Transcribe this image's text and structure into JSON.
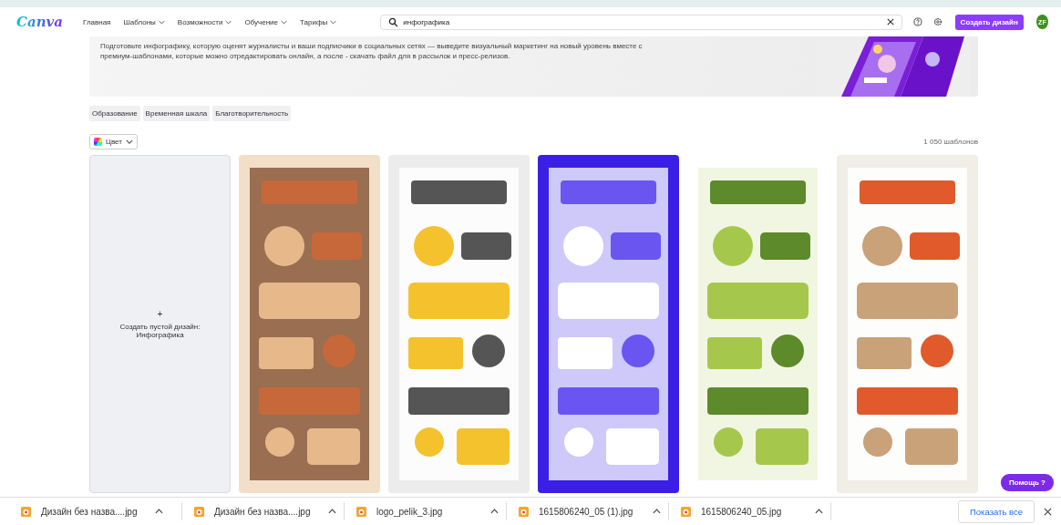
{
  "header": {
    "logo": "Canva",
    "nav": [
      {
        "label": "Главная",
        "dropdown": false
      },
      {
        "label": "Шаблоны",
        "dropdown": true
      },
      {
        "label": "Возможности",
        "dropdown": true
      },
      {
        "label": "Обучение",
        "dropdown": true
      },
      {
        "label": "Тарифы",
        "dropdown": true
      }
    ],
    "search": {
      "value": "инфографика"
    },
    "create_button": "Создать дизайн",
    "avatar": "ZF"
  },
  "banner": {
    "text": "Подготовьте инфографику, которую оценят журналисты и ваши подписчики в социальных сетях — выведите визуальный маркетинг на новый уровень вместе с премиум-шаблонами, которые можно отредактировать онлайн, а после - скачать файл для в рассылок и пресс-релизов.",
    "image": {
      "kind": "picture"
    }
  },
  "tags": [
    "Образование",
    "Временная шкала",
    "Благотворительность"
  ],
  "filter": {
    "label": "Цвет"
  },
  "count": "1 050 шаблонов",
  "cards": [
    {
      "kind": "blank",
      "icon": "+",
      "label": "Создать пустой дизайн: Инфографика"
    },
    {
      "kind": "picture"
    },
    {
      "kind": "picture"
    },
    {
      "kind": "picture"
    },
    {
      "kind": "picture"
    },
    {
      "kind": "picture"
    }
  ],
  "help_button": "Помощь ?",
  "downloads": {
    "items": [
      "Дизайн без назва....jpg",
      "Дизайн без назва....jpg",
      "logo_pelik_3.jpg",
      "1615806240_05 (1).jpg",
      "1615806240_05.jpg"
    ],
    "show_all": "Показать все"
  }
}
